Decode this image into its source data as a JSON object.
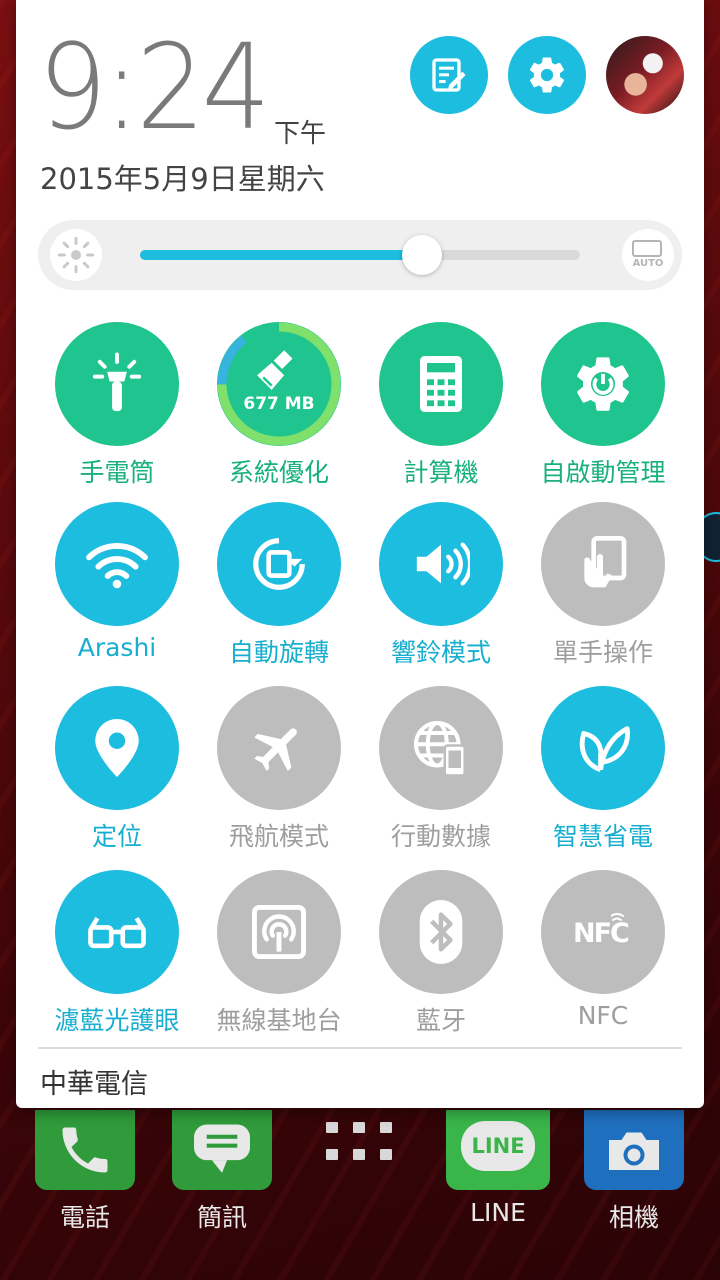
{
  "header": {
    "time": "9:24",
    "ampm": "下午",
    "date": "2015年5月9日星期六",
    "buttons": [
      {
        "name": "edit-icon",
        "color": "#1cbddf"
      },
      {
        "name": "gear-icon",
        "color": "#1cbddf"
      }
    ],
    "avatar_icon": "user-avatar"
  },
  "brightness": {
    "level_percent": 64,
    "auto_label": "AUTO",
    "icon": "brightness-sun-icon"
  },
  "tiles": [
    {
      "label": "手電筒",
      "icon": "flashlight-icon",
      "state": "green"
    },
    {
      "label": "系統優化",
      "icon": "broom-icon",
      "state": "green",
      "badge": "677 MB"
    },
    {
      "label": "計算機",
      "icon": "calculator-icon",
      "state": "green"
    },
    {
      "label": "自啟動管理",
      "icon": "auto-start-gear-icon",
      "state": "green"
    },
    {
      "label": "Arashi",
      "icon": "wifi-icon",
      "state": "on"
    },
    {
      "label": "自動旋轉",
      "icon": "rotate-icon",
      "state": "on"
    },
    {
      "label": "響鈴模式",
      "icon": "volume-icon",
      "state": "on"
    },
    {
      "label": "單手操作",
      "icon": "one-hand-icon",
      "state": "off"
    },
    {
      "label": "定位",
      "icon": "location-pin-icon",
      "state": "on"
    },
    {
      "label": "飛航模式",
      "icon": "airplane-icon",
      "state": "off"
    },
    {
      "label": "行動數據",
      "icon": "mobile-data-icon",
      "state": "off"
    },
    {
      "label": "智慧省電",
      "icon": "leaf-icon",
      "state": "on"
    },
    {
      "label": "濾藍光護眼",
      "icon": "glasses-icon",
      "state": "on"
    },
    {
      "label": "無線基地台",
      "icon": "hotspot-icon",
      "state": "off"
    },
    {
      "label": "藍牙",
      "icon": "bluetooth-icon",
      "state": "off"
    },
    {
      "label": "NFC",
      "icon": "nfc-icon",
      "state": "off"
    }
  ],
  "carrier": "中華電信",
  "dock": [
    {
      "label": "電話",
      "icon": "phone-icon"
    },
    {
      "label": "簡訊",
      "icon": "messages-icon"
    },
    {
      "label": "",
      "icon": "app-drawer-icon"
    },
    {
      "label": "LINE",
      "icon": "line-icon",
      "icon_text": "LINE"
    },
    {
      "label": "相機",
      "icon": "camera-icon"
    }
  ],
  "colors": {
    "accent_blue": "#1cbddf",
    "accent_green": "#1fc48e",
    "off_gray": "#bdbdbd"
  }
}
